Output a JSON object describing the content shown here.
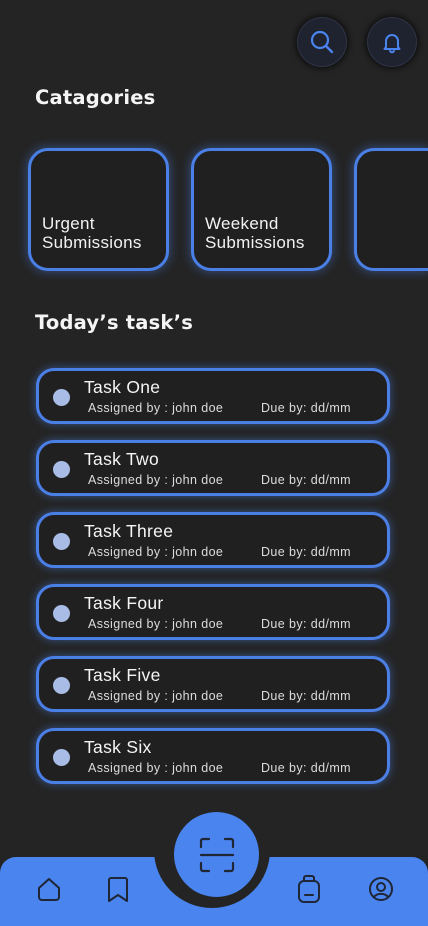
{
  "header": {
    "search_icon": "search-icon",
    "notification_icon": "bell-icon"
  },
  "categories": {
    "title": "Catagories",
    "items": [
      {
        "label": "Urgent\nSubmissions"
      },
      {
        "label": "Weekend\nSubmissions"
      },
      {
        "label": ""
      }
    ]
  },
  "tasks": {
    "title": "Today’s task’s",
    "items": [
      {
        "title": "Task One",
        "assigned": "Assigned by : john doe",
        "due": "Due by: dd/mm"
      },
      {
        "title": "Task Two",
        "assigned": "Assigned by : john doe",
        "due": "Due by: dd/mm"
      },
      {
        "title": "Task Three",
        "assigned": "Assigned by : john doe",
        "due": "Due by: dd/mm"
      },
      {
        "title": "Task Four",
        "assigned": "Assigned by : john doe",
        "due": "Due by: dd/mm"
      },
      {
        "title": "Task Five",
        "assigned": "Assigned by : john doe",
        "due": "Due by: dd/mm"
      },
      {
        "title": "Task Six",
        "assigned": "Assigned by : john doe",
        "due": "Due by: dd/mm"
      }
    ]
  },
  "bottom_nav": {
    "items": [
      "home-icon",
      "bookmark-icon",
      "scan-icon",
      "bag-icon",
      "profile-icon"
    ]
  },
  "colors": {
    "background": "#242424",
    "accent": "#4a84ee",
    "border": "#4a7fe6",
    "dot": "#a9bce6"
  }
}
